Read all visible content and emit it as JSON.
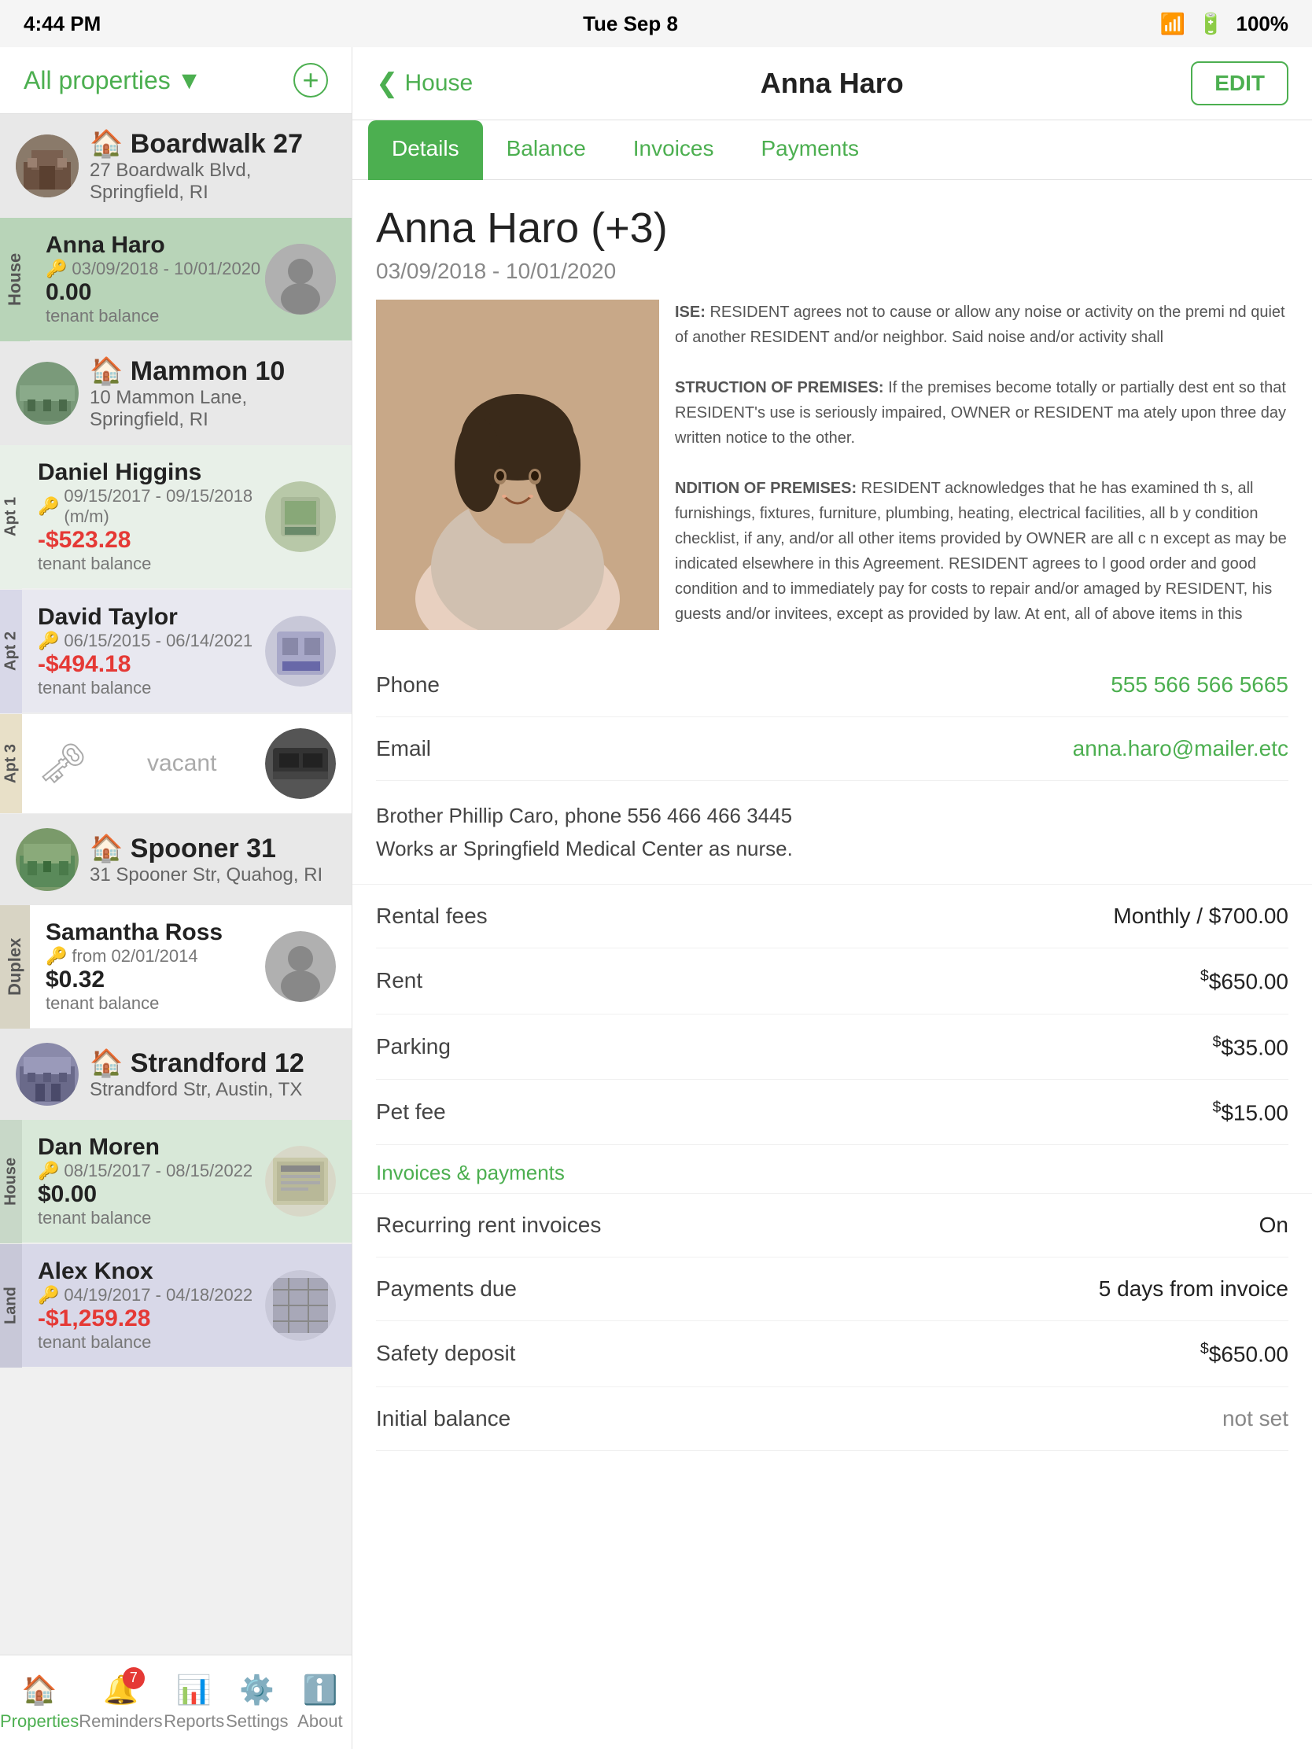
{
  "statusBar": {
    "time": "4:44 PM",
    "day": "Tue Sep 8",
    "battery": "100%"
  },
  "leftPanel": {
    "headerTitle": "All properties",
    "addIcon": "+",
    "properties": [
      {
        "id": "boardwalk27",
        "name": "Boardwalk 27",
        "address": "27 Boardwalk Blvd, Springfield, RI",
        "labelType": "House",
        "tenants": [
          {
            "name": "Anna Haro",
            "dateRange": "03/09/2018 - 10/01/2020",
            "balance": "0.00",
            "balanceType": "neutral",
            "balanceLabel": "tenant balance",
            "isActive": true,
            "aptLabel": null
          }
        ]
      },
      {
        "id": "mammon10",
        "name": "Mammon 10",
        "address": "10 Mammon Lane, Springfield, RI",
        "labelType": "Apt",
        "tenants": [
          {
            "name": "Daniel Higgins",
            "dateRange": "09/15/2017 - 09/15/2018 (m/m)",
            "balance": "-$523.28",
            "balanceType": "negative",
            "balanceLabel": "tenant balance",
            "isActive": false,
            "aptLabel": "Apt 1"
          },
          {
            "name": "David Taylor",
            "dateRange": "06/15/2015 - 06/14/2021",
            "balance": "-$494.18",
            "balanceType": "negative",
            "balanceLabel": "tenant balance",
            "isActive": false,
            "aptLabel": "Apt 2"
          },
          {
            "name": "vacant",
            "dateRange": "",
            "balance": "",
            "balanceType": "vacant",
            "balanceLabel": "",
            "isActive": false,
            "aptLabel": "Apt 3"
          }
        ]
      },
      {
        "id": "spooner31",
        "name": "Spooner 31",
        "address": "31 Spooner Str, Quahog, RI",
        "labelType": "Duplex",
        "tenants": [
          {
            "name": "Samantha Ross",
            "dateRange": "from 02/01/2014",
            "balance": "$0.32",
            "balanceType": "neutral",
            "balanceLabel": "tenant balance",
            "isActive": false,
            "aptLabel": null
          }
        ]
      },
      {
        "id": "strandford12",
        "name": "Strandford 12",
        "address": "Strandford Str, Austin, TX",
        "labelType": "House/Land",
        "tenants": [
          {
            "name": "Dan Moren",
            "dateRange": "08/15/2017 - 08/15/2022",
            "balance": "$0.00",
            "balanceType": "neutral",
            "balanceLabel": "tenant balance",
            "isActive": false,
            "aptLabel": "House"
          },
          {
            "name": "Alex Knox",
            "dateRange": "04/19/2017 - 04/18/2022",
            "balance": "-$1,259.28",
            "balanceType": "negative",
            "balanceLabel": "tenant balance",
            "isActive": false,
            "aptLabel": "Land"
          }
        ]
      }
    ]
  },
  "rightPanel": {
    "backLabel": "House",
    "title": "Anna Haro",
    "editLabel": "EDIT",
    "tabs": [
      "Details",
      "Balance",
      "Invoices",
      "Payments"
    ],
    "activeTab": "Details",
    "tenantName": "Anna Haro (+3)",
    "tenantDates": "03/09/2018 - 10/01/2020",
    "leaseText": "ISE: RESIDENT agrees not to cause or allow any noise or activity on the premi nd quiet of another RESIDENT and/or neighbor. Said noise and/or activity shall \n\nSTRUCTION OF PREMISES: If the premises become totally or partially destre ent so that RESIDENT's use is seriously impaired, OWNER or RESIDENT ma ately upon three day written notice to the other.\n\nNDITION OF PREMISES: RESIDENT acknowledges that he has examined th s, all furnishings, fixtures, furniture, plumbing, heating, electrical facilities, all b y condition checklist, if any, and/or all other items provided by OWNER are all c n except as may be indicated elsewhere in this Agreement. RESIDENT agrees to I good order and good condition and to immediately pay for costs to repair and/or amaged by RESIDENT, his guests and/or invitees, except as provided by law. At ent, all of above items in this provision shall be returned to OWNER in clean an ble wear and tear and the premises shall be free of all personal property and tras d that all dirt, holes, tears, burns, and stains of any size or amount in the carpets, or part of the premises, do not constitute reasonable wear and tear.\n\nTERATIONS: RESIDENT shall not paint, wallpaper, alter or redecorate, chang, or other equipment, screws, fastening devices, large nails, or adhesive materials. hibits, on or in any portion of the premises without the written consent of the O d by law.\n\nOPERTY MAINTENANCE: RESIDENT shall deposit all garbage and waste in proper receptacles and shall cooperate in keeping the garbage area neat and clea ble for disposing of items of such size and nature as are not normally acceptable NT shall be responsible for keeping the kitchen and bathroom drains free of thrs g of the drains. RESIDENT shall pay for the cleaning out of any plumbing fixtur age and for the expense or damage caused by stopping of waste pipes or overflo\n\nUSE RULES: RESIDENT shall comply with all house rules as stated on separate part of this rental agreement, and a violation of any of the house rules is consid mt.",
    "phone": "555 566 566 5665",
    "email": "anna.haro@mailer.etc",
    "emergencyContact": "Brother Phillip Caro, phone 556 466 466 3445\nWorks ar Springfield Medical Center as nurse.",
    "details": {
      "rentalFees": "Monthly / $700.00",
      "rent": "$650.00",
      "parking": "$35.00",
      "petFee": "$15.00",
      "recurringRentInvoices": "On",
      "paymentsDue": "5 days from invoice",
      "safetyDeposit": "$650.00",
      "initialBalance": "not set"
    },
    "labels": {
      "rentalFees": "Rental fees",
      "rent": "Rent",
      "parking": "Parking",
      "petFee": "Pet fee",
      "invoicesPayments": "Invoices & payments",
      "recurringRentInvoices": "Recurring rent invoices",
      "paymentsDue": "Payments due",
      "safetyDeposit": "Safety deposit",
      "initialBalance": "Initial balance"
    }
  },
  "bottomNav": {
    "items": [
      {
        "icon": "🏠",
        "label": "Properties",
        "active": true,
        "badge": null
      },
      {
        "icon": "🔔",
        "label": "Reminders",
        "active": false,
        "badge": "7"
      },
      {
        "icon": "📊",
        "label": "Reports",
        "active": false,
        "badge": null
      },
      {
        "icon": "⚙️",
        "label": "Settings",
        "active": false,
        "badge": null
      },
      {
        "icon": "ℹ️",
        "label": "About",
        "active": false,
        "badge": null
      }
    ]
  }
}
